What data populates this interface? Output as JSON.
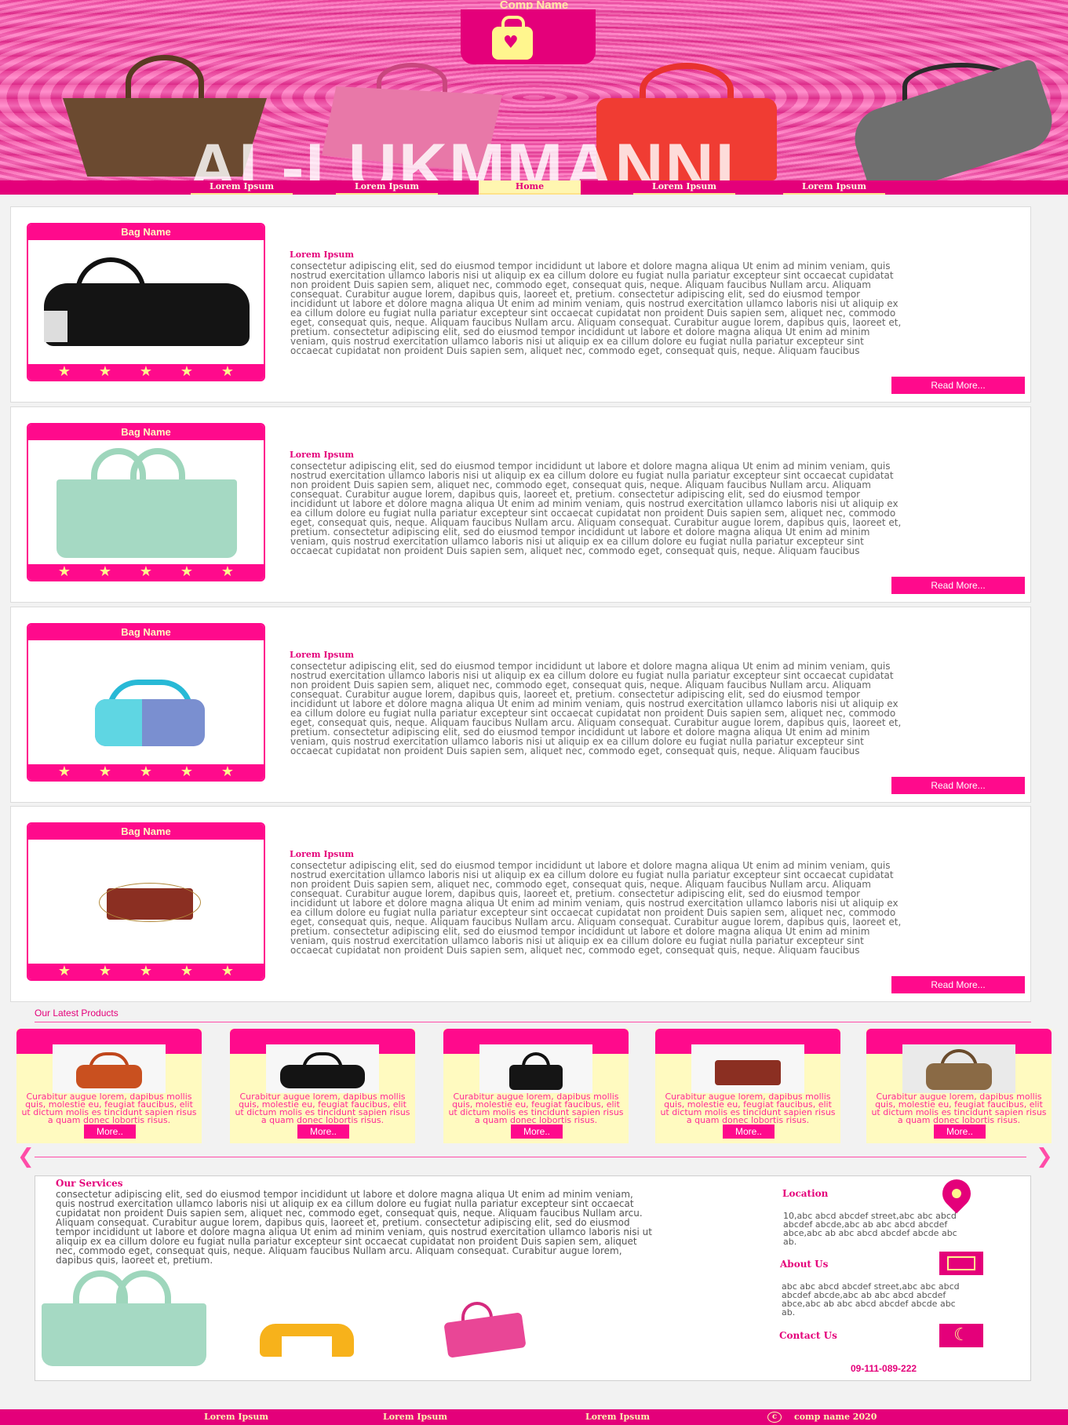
{
  "header": {
    "comp_name": "Comp Name",
    "big_title": "AL-LUKMMANNI",
    "nav": [
      {
        "label": "Lorem Ipsum"
      },
      {
        "label": "Lorem Ipsum"
      },
      {
        "label": "Home"
      },
      {
        "label": "Lorem Ipsum"
      },
      {
        "label": "Lorem Ipsum"
      }
    ]
  },
  "products": [
    {
      "name": "Bag Name",
      "rating": 5,
      "title": "Lorem Ipsum",
      "read_more": "Read More...",
      "text": "consectetur adipiscing elit, sed do eiusmod tempor incididunt ut labore et dolore magna aliqua Ut enim ad minim veniam, quis nostrud exercitation ullamco laboris nisi ut aliquip ex ea cillum dolore eu fugiat nulla pariatur excepteur sint occaecat cupidatat non proident Duis sapien sem, aliquet nec, commodo eget, consequat quis, neque. Aliquam faucibus Nullam arcu. Aliquam consequat. Curabitur augue lorem, dapibus quis, laoreet et, pretium. consectetur adipiscing elit, sed do eiusmod tempor incididunt ut labore et dolore magna aliqua Ut enim ad minim veniam, quis nostrud exercitation ullamco laboris nisi ut aliquip ex ea cillum dolore eu fugiat nulla pariatur excepteur sint occaecat cupidatat non proident Duis sapien sem, aliquet nec, commodo eget, consequat quis, neque. Aliquam faucibus Nullam arcu. Aliquam consequat. Curabitur augue lorem, dapibus quis, laoreet et, pretium. consectetur adipiscing elit, sed do eiusmod tempor incididunt ut labore et dolore magna aliqua Ut enim ad minim veniam, quis nostrud exercitation ullamco laboris nisi ut aliquip ex ea cillum dolore eu fugiat nulla pariatur excepteur sint occaecat cupidatat non proident Duis sapien sem, aliquet nec, commodo eget, consequat quis, neque. Aliquam faucibus"
    },
    {
      "name": "Bag Name",
      "rating": 5,
      "title": "Lorem Ipsum",
      "read_more": "Read More...",
      "text": "consectetur adipiscing elit, sed do eiusmod tempor incididunt ut labore et dolore magna aliqua Ut enim ad minim veniam, quis nostrud exercitation ullamco laboris nisi ut aliquip ex ea cillum dolore eu fugiat nulla pariatur excepteur sint occaecat cupidatat non proident Duis sapien sem, aliquet nec, commodo eget, consequat quis, neque. Aliquam faucibus Nullam arcu. Aliquam consequat. Curabitur augue lorem, dapibus quis, laoreet et, pretium. consectetur adipiscing elit, sed do eiusmod tempor incididunt ut labore et dolore magna aliqua Ut enim ad minim veniam, quis nostrud exercitation ullamco laboris nisi ut aliquip ex ea cillum dolore eu fugiat nulla pariatur excepteur sint occaecat cupidatat non proident Duis sapien sem, aliquet nec, commodo eget, consequat quis, neque. Aliquam faucibus Nullam arcu. Aliquam consequat. Curabitur augue lorem, dapibus quis, laoreet et, pretium. consectetur adipiscing elit, sed do eiusmod tempor incididunt ut labore et dolore magna aliqua Ut enim ad minim veniam, quis nostrud exercitation ullamco laboris nisi ut aliquip ex ea cillum dolore eu fugiat nulla pariatur excepteur sint occaecat cupidatat non proident Duis sapien sem, aliquet nec, commodo eget, consequat quis, neque. Aliquam faucibus"
    },
    {
      "name": "Bag Name",
      "rating": 5,
      "title": "Lorem Ipsum",
      "read_more": "Read More...",
      "text": "consectetur adipiscing elit, sed do eiusmod tempor incididunt ut labore et dolore magna aliqua Ut enim ad minim veniam, quis nostrud exercitation ullamco laboris nisi ut aliquip ex ea cillum dolore eu fugiat nulla pariatur excepteur sint occaecat cupidatat non proident Duis sapien sem, aliquet nec, commodo eget, consequat quis, neque. Aliquam faucibus Nullam arcu. Aliquam consequat. Curabitur augue lorem, dapibus quis, laoreet et, pretium. consectetur adipiscing elit, sed do eiusmod tempor incididunt ut labore et dolore magna aliqua Ut enim ad minim veniam, quis nostrud exercitation ullamco laboris nisi ut aliquip ex ea cillum dolore eu fugiat nulla pariatur excepteur sint occaecat cupidatat non proident Duis sapien sem, aliquet nec, commodo eget, consequat quis, neque. Aliquam faucibus Nullam arcu. Aliquam consequat. Curabitur augue lorem, dapibus quis, laoreet et, pretium. consectetur adipiscing elit, sed do eiusmod tempor incididunt ut labore et dolore magna aliqua Ut enim ad minim veniam, quis nostrud exercitation ullamco laboris nisi ut aliquip ex ea cillum dolore eu fugiat nulla pariatur excepteur sint occaecat cupidatat non proident Duis sapien sem, aliquet nec, commodo eget, consequat quis, neque. Aliquam faucibus"
    },
    {
      "name": "Bag Name",
      "rating": 5,
      "title": "Lorem Ipsum",
      "read_more": "Read More...",
      "text": "consectetur adipiscing elit, sed do eiusmod tempor incididunt ut labore et dolore magna aliqua Ut enim ad minim veniam, quis nostrud exercitation ullamco laboris nisi ut aliquip ex ea cillum dolore eu fugiat nulla pariatur excepteur sint occaecat cupidatat non proident Duis sapien sem, aliquet nec, commodo eget, consequat quis, neque. Aliquam faucibus Nullam arcu. Aliquam consequat. Curabitur augue lorem, dapibus quis, laoreet et, pretium. consectetur adipiscing elit, sed do eiusmod tempor incididunt ut labore et dolore magna aliqua Ut enim ad minim veniam, quis nostrud exercitation ullamco laboris nisi ut aliquip ex ea cillum dolore eu fugiat nulla pariatur excepteur sint occaecat cupidatat non proident Duis sapien sem, aliquet nec, commodo eget, consequat quis, neque. Aliquam faucibus Nullam arcu. Aliquam consequat. Curabitur augue lorem, dapibus quis, laoreet et, pretium. consectetur adipiscing elit, sed do eiusmod tempor incididunt ut labore et dolore magna aliqua Ut enim ad minim veniam, quis nostrud exercitation ullamco laboris nisi ut aliquip ex ea cillum dolore eu fugiat nulla pariatur excepteur sint occaecat cupidatat non proident Duis sapien sem, aliquet nec, commodo eget, consequat quis, neque. Aliquam faucibus"
    }
  ],
  "latest": {
    "title": "Our Latest Products",
    "items": [
      {
        "text": "Curabitur augue lorem, dapibus mollis quis, molestie eu, feugiat faucibus, elit ut dictum molis es tincidunt sapien risus a quam donec lobortis risus.",
        "more": "More.."
      },
      {
        "text": "Curabitur augue lorem, dapibus mollis quis, molestie eu, feugiat faucibus, elit ut dictum molis es tincidunt sapien risus a quam donec lobortis risus.",
        "more": "More.."
      },
      {
        "text": "Curabitur augue lorem, dapibus mollis quis, molestie eu, feugiat faucibus, elit ut dictum molis es tincidunt sapien risus a quam donec lobortis risus.",
        "more": "More.."
      },
      {
        "text": "Curabitur augue lorem, dapibus mollis quis, molestie eu, feugiat faucibus, elit ut dictum molis es tincidunt sapien risus a quam donec lobortis risus.",
        "more": "More.."
      },
      {
        "text": "Curabitur augue lorem, dapibus mollis quis, molestie eu, feugiat faucibus, elit ut dictum molis es tincidunt sapien risus a quam donec lobortis risus.",
        "more": "More.."
      }
    ],
    "prev_arrow": "❮",
    "next_arrow": "❯"
  },
  "services": {
    "title": "Our Services",
    "text": "consectetur adipiscing elit, sed do eiusmod tempor incididunt ut labore et dolore magna aliqua Ut enim ad minim veniam, quis nostrud exercitation ullamco laboris nisi ut aliquip ex ea cillum dolore eu fugiat nulla pariatur excepteur sint occaecat cupidatat non proident Duis sapien sem, aliquet nec, commodo eget, consequat quis, neque. Aliquam faucibus Nullam arcu. Aliquam consequat. Curabitur augue lorem, dapibus quis, laoreet et, pretium. consectetur adipiscing elit, sed do eiusmod tempor incididunt ut labore et dolore magna aliqua Ut enim ad minim veniam, quis nostrud exercitation ullamco laboris nisi ut aliquip ex ea cillum dolore eu fugiat nulla pariatur excepteur sint occaecat cupidatat non proident Duis sapien sem, aliquet nec, commodo eget, consequat quis, neque. Aliquam faucibus Nullam arcu. Aliquam consequat. Curabitur augue lorem, dapibus quis, laoreet et, pretium.",
    "location_title": "Location",
    "location_text": "10,abc abcd abcdef street,abc abc abcd abcdef abcde,abc ab abc abcd abcdef abce,abc ab abc abcd abcdef abcde abc ab.",
    "about_title": "About Us",
    "about_text": "abc abc abcd abcdef street,abc abc abcd abcdef abcde,abc ab abc abcd abcdef abce,abc ab abc abcd abcdef abcde abc ab.",
    "contact_title": "Contact Us",
    "phone": "09-111-089-222"
  },
  "footer": {
    "items": [
      "Lorem Ipsum",
      "Lorem Ipsum",
      "Lorem Ipsum"
    ],
    "copyright_symbol": "c",
    "copyright": "comp name 2020"
  },
  "colors": {
    "primary": "#e4007a",
    "accent": "#ff0a8c",
    "highlight": "#fff68e",
    "cream": "#fffac0"
  },
  "icons": [
    "heart-bag-logo-icon",
    "star-icon",
    "location-pin-icon",
    "id-card-icon",
    "phone-icon",
    "prev-arrow-icon",
    "next-arrow-icon"
  ]
}
